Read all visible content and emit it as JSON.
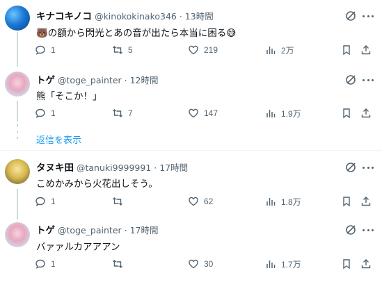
{
  "tweets": [
    {
      "name": "キナコキノコ",
      "handle": "@kinokokinako346 · 13時間",
      "text": "🐻の額から閃光とあの音が出たら本当に困る😅",
      "replies": "1",
      "retweets": "5",
      "likes": "219",
      "views": "2万"
    },
    {
      "name": "トゲ",
      "handle": "@toge_painter · 12時間",
      "text": "熊「そこか！」",
      "replies": "1",
      "retweets": "7",
      "likes": "147",
      "views": "1.9万"
    },
    {
      "name": "タヌキ田",
      "handle": "@tanuki9999991 · 17時間",
      "text": "こめかみから火花出しそう。",
      "replies": "1",
      "retweets": "",
      "likes": "62",
      "views": "1.8万"
    },
    {
      "name": "トゲ",
      "handle": "@toge_painter · 17時間",
      "text": "バァァルカアアアン",
      "replies": "1",
      "retweets": "",
      "likes": "30",
      "views": "1.7万"
    }
  ],
  "show_replies_label": "返信を表示",
  "colors": {
    "link": "#1d9bf0",
    "secondary": "#536471",
    "divider": "#eff3f4"
  }
}
